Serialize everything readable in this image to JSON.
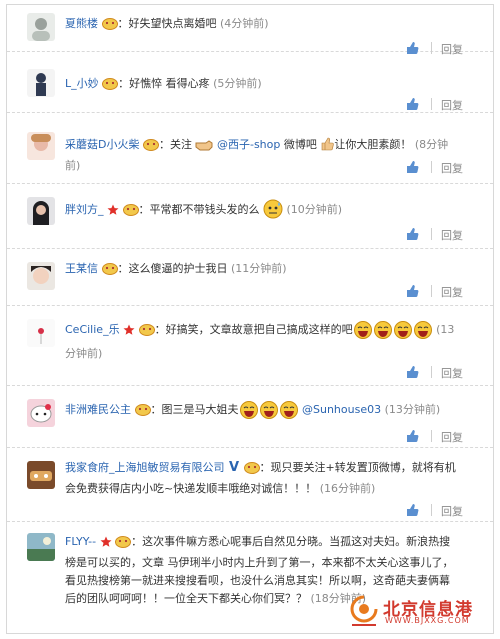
{
  "reply_label": "回复",
  "colors": {
    "link": "#2a64b0",
    "time": "#8a8a8a",
    "watermark": "#d23a2e"
  },
  "comments": [
    {
      "user": "夏熊楼",
      "text": "：好失望快点离婚吧",
      "time": "(4分钟前)"
    },
    {
      "user": "L_小妙",
      "text": "：好憔悴 看得心疼",
      "time": "(5分钟前)"
    },
    {
      "user": "采蘑菇D小火柴",
      "text_a": "：关注",
      "mention": "@西子-shop",
      "text_b": " 微博吧",
      "text_c": "让你大胆素颜！",
      "time": "(8分钟前)"
    },
    {
      "user": "胖刘方_",
      "text": "：平常都不带钱头发的么",
      "time": "(10分钟前)"
    },
    {
      "user": "王某信",
      "text": "：这么傻逼的护士我日",
      "time": "(11分钟前)"
    },
    {
      "user": "CeCilie_乐",
      "text": "：好搞笑，文章故意把自己搞成这样的吧",
      "time": "(13分钟前)"
    },
    {
      "user": "非洲难民公主",
      "text": "：图三是马大姐夫",
      "mention": "@Sunhouse03",
      "time": "(13分钟前)"
    },
    {
      "user": "我家食府_上海旭敏贸易有限公司",
      "text": "：现只要关注+转发置顶微博，就将有机会免费获得店内小吃~快递发顺丰哦绝对诚信！！！",
      "time": "(16分钟前)"
    },
    {
      "user": "FLYY--",
      "text": "：这次事件嘛方悉心呢事后自然见分晓。当孤这对夫妇。新浪热搜榜是可以买的，文章 马伊琍半小时内上升到了第一，本来都不太关心这事儿了，看见热搜榜第一就进来搜搜看呗，也没什么消息其实！所以啊，这奇葩夫妻俩幕后的团队呵呵呵！！一位全天下都关心你们冥？？",
      "time": "(18分钟前)"
    }
  ],
  "watermark": {
    "title": "北京信息港",
    "url": "WWW.BJXXG.COM"
  }
}
